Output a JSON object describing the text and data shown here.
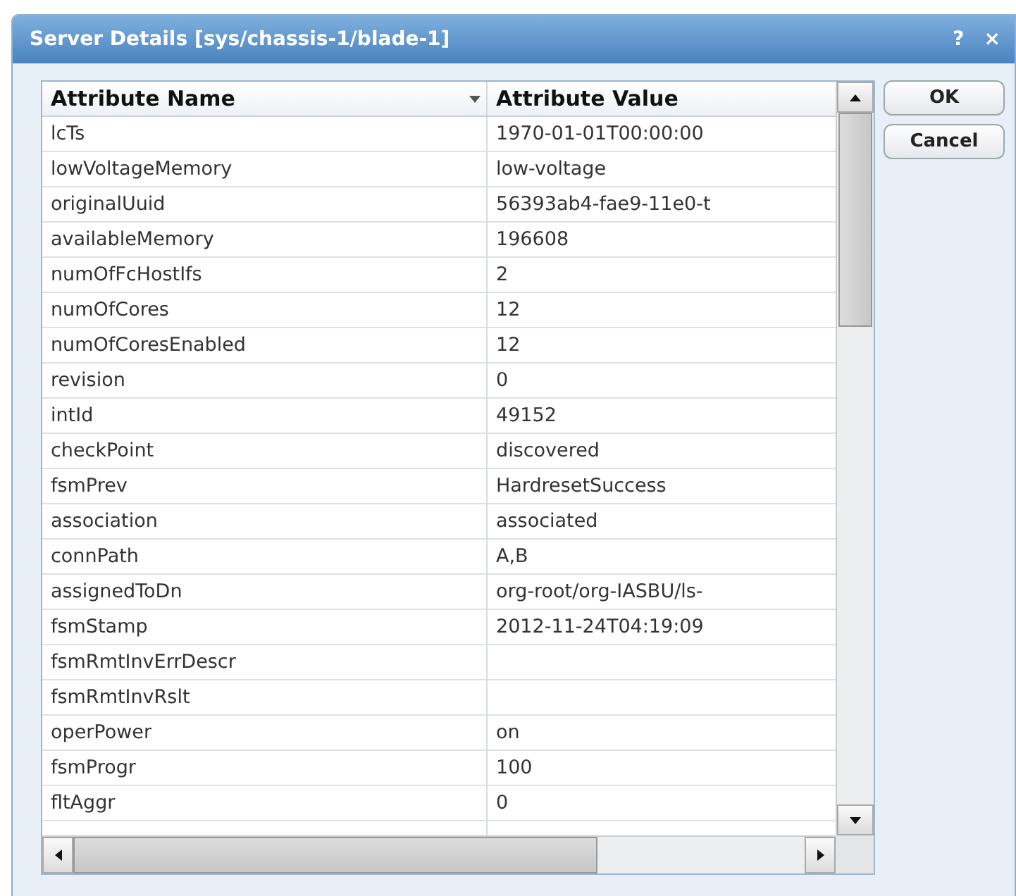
{
  "window": {
    "title": "Server Details [sys/chassis-1/blade-1]",
    "title_buttons": [
      "?",
      "×"
    ]
  },
  "table": {
    "columns": [
      {
        "label": "Attribute Name",
        "sorted": true
      },
      {
        "label": "Attribute Value",
        "sorted": false
      }
    ],
    "rows": [
      {
        "name": "lcTs",
        "value": "1970-01-01T00:00:00"
      },
      {
        "name": "lowVoltageMemory",
        "value": "low-voltage"
      },
      {
        "name": "originalUuid",
        "value": "56393ab4-fae9-11e0-t"
      },
      {
        "name": "availableMemory",
        "value": "196608"
      },
      {
        "name": "numOfFcHostIfs",
        "value": "2"
      },
      {
        "name": "numOfCores",
        "value": "12"
      },
      {
        "name": "numOfCoresEnabled",
        "value": "12"
      },
      {
        "name": "revision",
        "value": "0"
      },
      {
        "name": "intId",
        "value": "49152"
      },
      {
        "name": "checkPoint",
        "value": "discovered"
      },
      {
        "name": "fsmPrev",
        "value": "HardresetSuccess"
      },
      {
        "name": "association",
        "value": "associated"
      },
      {
        "name": "connPath",
        "value": "A,B"
      },
      {
        "name": "assignedToDn",
        "value": "org-root/org-IASBU/ls-"
      },
      {
        "name": "fsmStamp",
        "value": "2012-11-24T04:19:09"
      },
      {
        "name": "fsmRmtInvErrDescr",
        "value": ""
      },
      {
        "name": "fsmRmtInvRslt",
        "value": ""
      },
      {
        "name": "operPower",
        "value": "on"
      },
      {
        "name": "fsmProgr",
        "value": "100"
      },
      {
        "name": "fltAggr",
        "value": "0"
      }
    ]
  },
  "buttons": [
    "OK",
    "Cancel"
  ]
}
